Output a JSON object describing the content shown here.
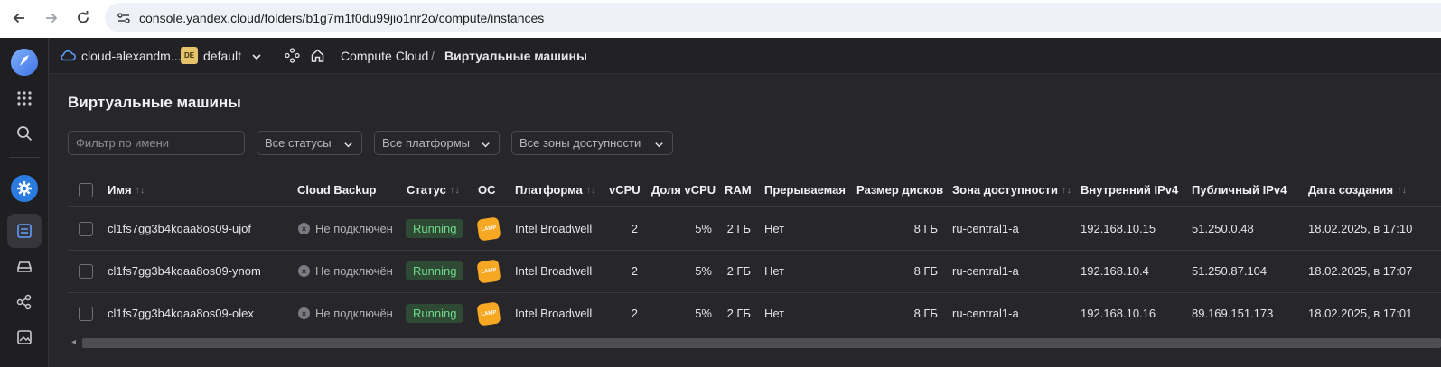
{
  "browser": {
    "url": "console.yandex.cloud/folders/b1g7m1f0du99jio1nr2o/compute/instances"
  },
  "topbar": {
    "cloud_name": "cloud-alexandm...",
    "folder_badge": "DE",
    "folder_name": "default",
    "breadcrumb_service": "Compute Cloud",
    "breadcrumb_separator": "/",
    "breadcrumb_current": "Виртуальные машины"
  },
  "page": {
    "title": "Виртуальные машины"
  },
  "filters": {
    "name_placeholder": "Фильтр по имени",
    "status": "Все статусы",
    "platform": "Все платформы",
    "zone": "Все зоны доступности"
  },
  "table": {
    "columns": [
      "Имя",
      "Cloud Backup",
      "Статус",
      "ОС",
      "Платформа",
      "vCPU",
      "Доля vCPU",
      "RAM",
      "Прерываемая",
      "Размер дисков",
      "Зона доступности",
      "Внутренний IPv4",
      "Публичный IPv4",
      "Дата создания"
    ],
    "sort_glyph": "↑↓",
    "rows": [
      {
        "name": "cl1fs7gg3b4kqaa8os09-ujof",
        "backup": "Не подключён",
        "status": "Running",
        "os": "LAMP",
        "platform": "Intel Broadwell",
        "vcpu": "2",
        "vcpu_share": "5%",
        "ram": "2 ГБ",
        "preemptible": "Нет",
        "disk": "8 ГБ",
        "zone": "ru-central1-a",
        "internal_ip": "192.168.10.15",
        "public_ip": "51.250.0.48",
        "created": "18.02.2025, в 17:10"
      },
      {
        "name": "cl1fs7gg3b4kqaa8os09-ynom",
        "backup": "Не подключён",
        "status": "Running",
        "os": "LAMP",
        "platform": "Intel Broadwell",
        "vcpu": "2",
        "vcpu_share": "5%",
        "ram": "2 ГБ",
        "preemptible": "Нет",
        "disk": "8 ГБ",
        "zone": "ru-central1-a",
        "internal_ip": "192.168.10.4",
        "public_ip": "51.250.87.104",
        "created": "18.02.2025, в 17:07"
      },
      {
        "name": "cl1fs7gg3b4kqaa8os09-olex",
        "backup": "Не подключён",
        "status": "Running",
        "os": "LAMP",
        "platform": "Intel Broadwell",
        "vcpu": "2",
        "vcpu_share": "5%",
        "ram": "2 ГБ",
        "preemptible": "Нет",
        "disk": "8 ГБ",
        "zone": "ru-central1-a",
        "internal_ip": "192.168.10.16",
        "public_ip": "89.169.151.173",
        "created": "18.02.2025, в 17:01"
      }
    ]
  },
  "colors": {
    "background": "#27272b",
    "status_running_bg": "#2e4a35",
    "status_running_text": "#71d98a",
    "os_badge": "#f7a823",
    "folder_badge": "#e6c26a"
  }
}
